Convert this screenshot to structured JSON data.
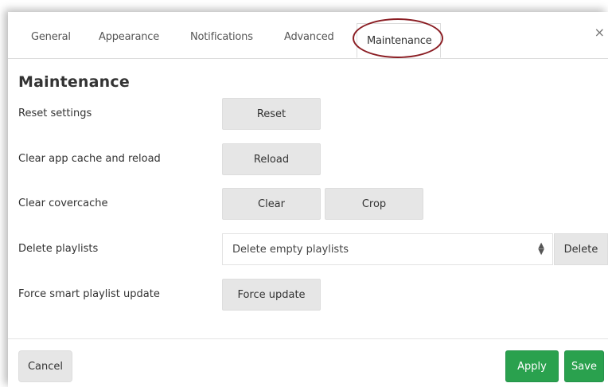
{
  "tabs": {
    "general": "General",
    "appearance": "Appearance",
    "notifications": "Notifications",
    "advanced": "Advanced",
    "maintenance": "Maintenance",
    "active": "Maintenance"
  },
  "close_label": "×",
  "section_title": "Maintenance",
  "rows": {
    "reset": {
      "label": "Reset settings",
      "button": "Reset"
    },
    "reload": {
      "label": "Clear app cache and reload",
      "button": "Reload"
    },
    "covercache": {
      "label": "Clear covercache",
      "clear_button": "Clear",
      "crop_button": "Crop"
    },
    "playlists": {
      "label": "Delete playlists",
      "selected_option": "Delete empty playlists",
      "button": "Delete"
    },
    "smart": {
      "label": "Force smart playlist update",
      "button": "Force update"
    }
  },
  "footer": {
    "cancel": "Cancel",
    "apply": "Apply",
    "save": "Save"
  },
  "colors": {
    "primary_green": "#2aa14e",
    "highlight_circle": "#8b1e24"
  }
}
